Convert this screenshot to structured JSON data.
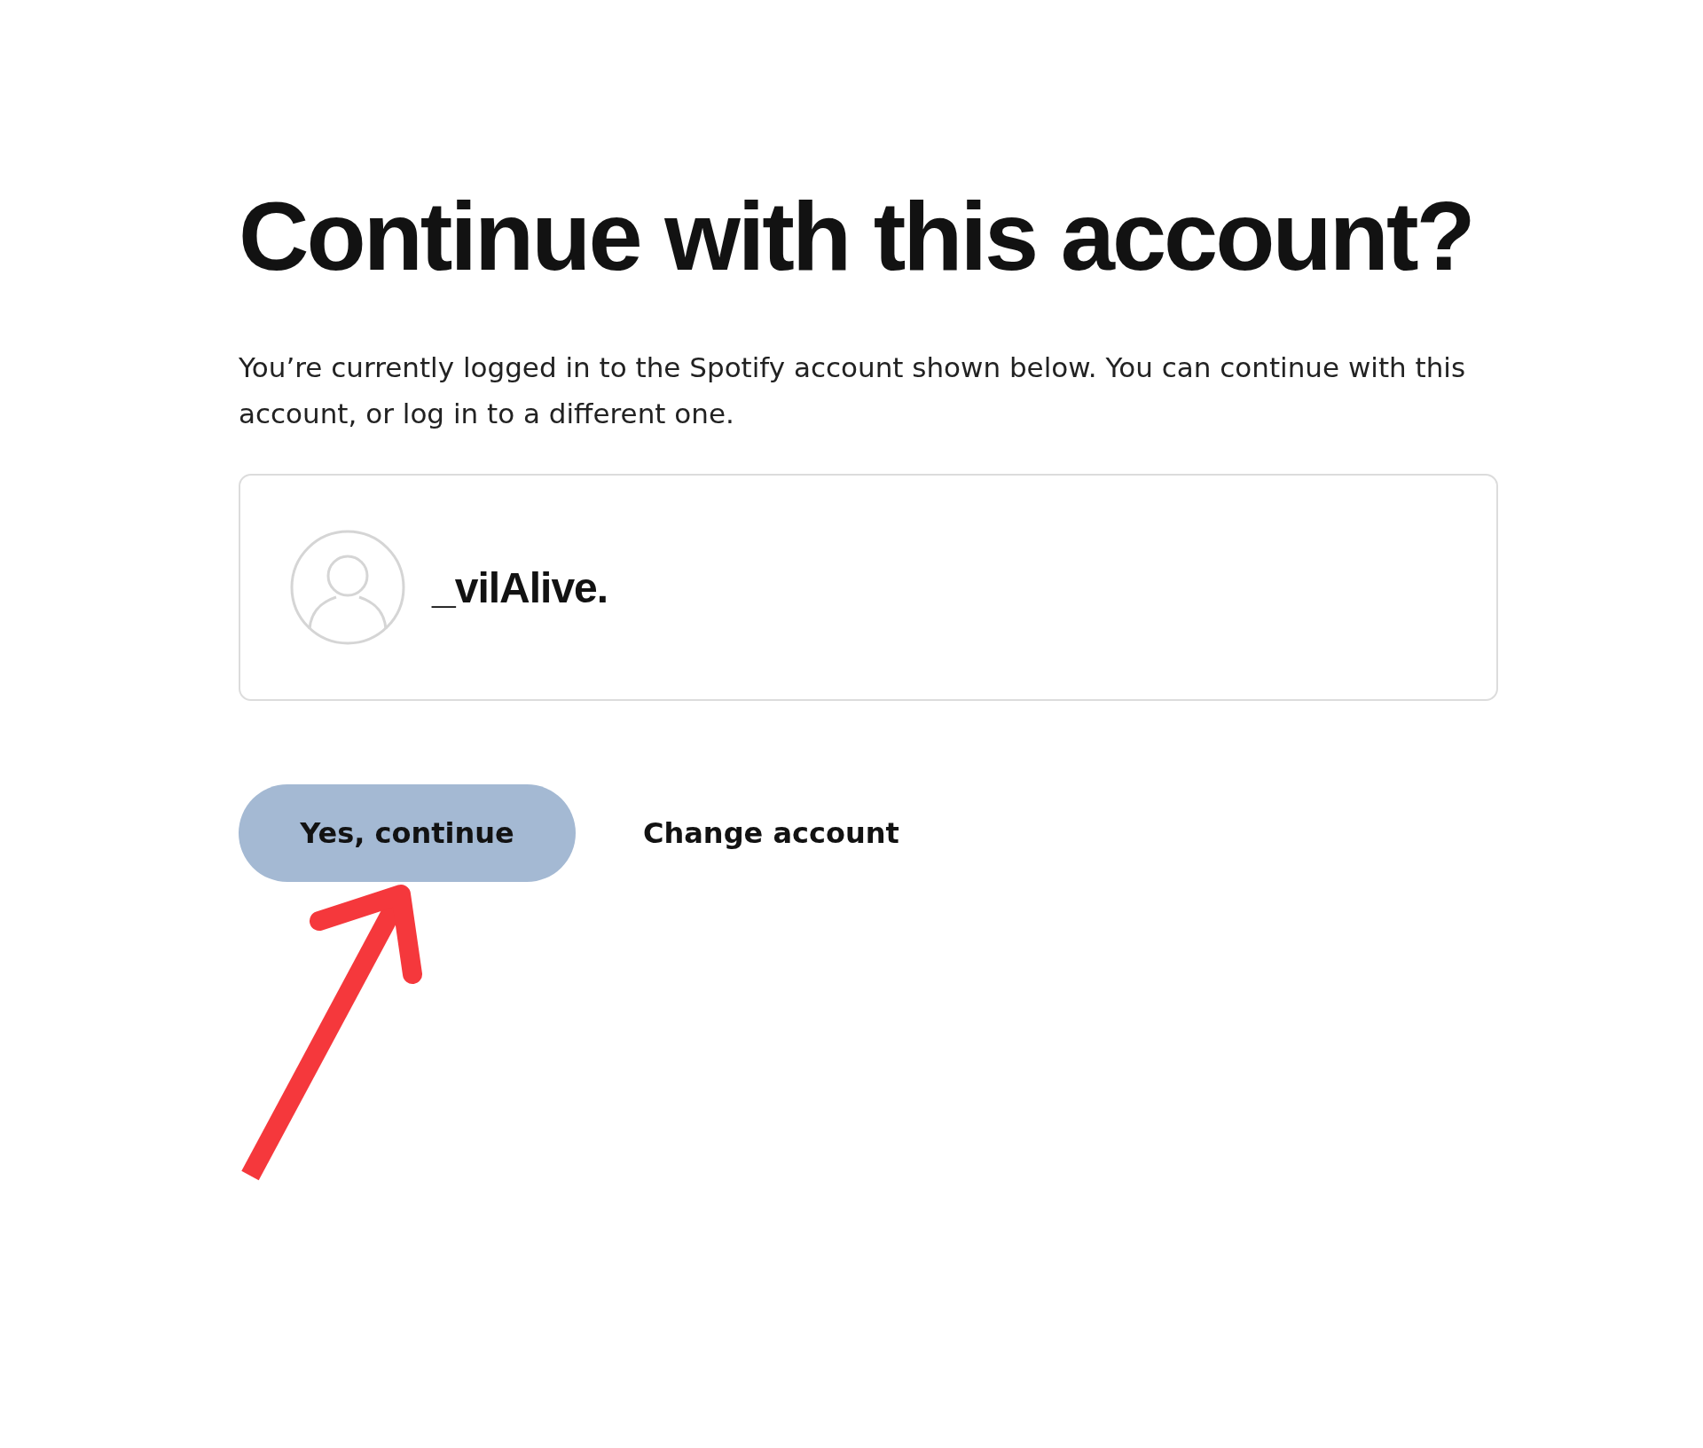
{
  "heading": "Continue with this account?",
  "description": "You’re currently logged in to the Spotify account shown below. You can continue with this account, or log in to a different one.",
  "account": {
    "username": "_vilAlive."
  },
  "buttons": [
    {
      "kind": "primary",
      "label": "Yes, continue"
    },
    {
      "kind": "link",
      "label": "Change account"
    }
  ]
}
